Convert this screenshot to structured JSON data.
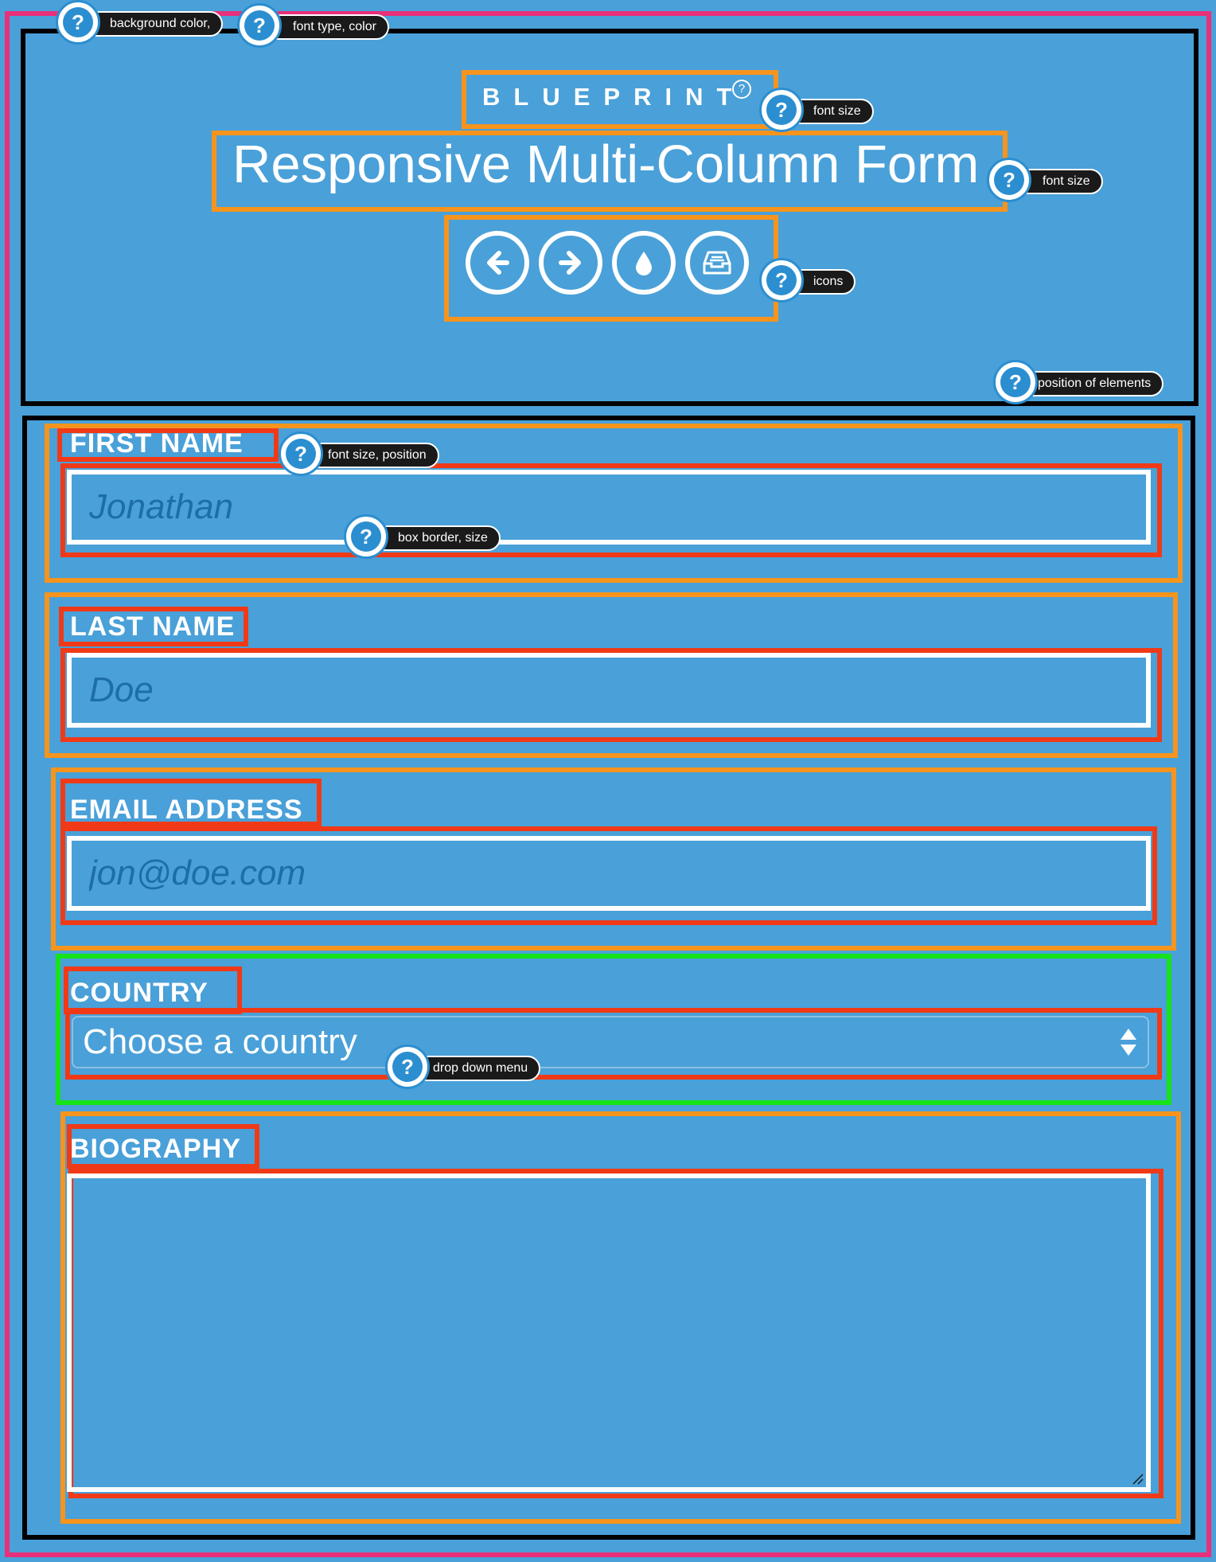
{
  "header": {
    "brand": "BLUEPRINT",
    "brand_mark": "?",
    "title": "Responsive Multi-Column Form",
    "nav_icons": [
      "arrow-left-icon",
      "arrow-right-icon",
      "droplet-icon",
      "inbox-icon"
    ]
  },
  "form": {
    "first_name": {
      "label": "FIRST NAME",
      "placeholder": "Jonathan"
    },
    "last_name": {
      "label": "LAST NAME",
      "placeholder": "Doe"
    },
    "email": {
      "label": "EMAIL ADDRESS",
      "placeholder": "jon@doe.com"
    },
    "country": {
      "label": "COUNTRY",
      "selected": "Choose a country"
    },
    "biography": {
      "label": "BIOGRAPHY",
      "value": ""
    }
  },
  "help_tags": {
    "background": "background color,",
    "font_type": "font type, color",
    "brand_font_size": "font size",
    "title_font_size": "font size",
    "icons": "icons",
    "position": "position of elements",
    "first_label": "font size, position",
    "box_border": "box border, size",
    "dropdown": "drop down menu"
  },
  "help_mark": "?",
  "colors": {
    "background": "#4aa0d8",
    "placeholder": "#1c6fa6",
    "annotation_pink": "#e8307a",
    "annotation_orange": "#f7941d",
    "annotation_red": "#f03a17",
    "annotation_green": "#16e31a"
  }
}
